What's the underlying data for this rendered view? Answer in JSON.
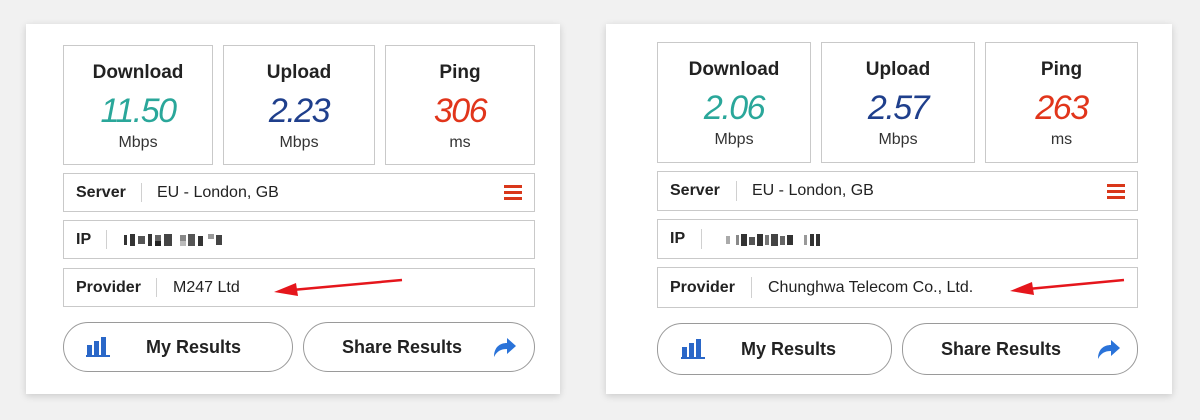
{
  "colors": {
    "download": "#2aa79a",
    "upload": "#1f3f8c",
    "ping": "#e1351b",
    "menu_icon": "#d9371a",
    "annotation_arrow": "#e5161c",
    "chart_icon": "#2a67c8",
    "share_icon": "#2a73d9"
  },
  "panels": [
    {
      "download": {
        "label": "Download",
        "value": "11.50",
        "unit": "Mbps"
      },
      "upload": {
        "label": "Upload",
        "value": "2.23",
        "unit": "Mbps"
      },
      "ping": {
        "label": "Ping",
        "value": "306",
        "unit": "ms"
      },
      "server": {
        "label": "Server",
        "value": "EU - London, GB",
        "menu_icon": "hamburger-menu-icon"
      },
      "ip": {
        "label": "IP"
      },
      "provider": {
        "label": "Provider",
        "value": "M247 Ltd"
      },
      "my_results": {
        "label": "My Results",
        "icon": "bar-chart-icon"
      },
      "share_results": {
        "label": "Share Results",
        "icon": "share-arrow-icon"
      }
    },
    {
      "download": {
        "label": "Download",
        "value": "2.06",
        "unit": "Mbps"
      },
      "upload": {
        "label": "Upload",
        "value": "2.57",
        "unit": "Mbps"
      },
      "ping": {
        "label": "Ping",
        "value": "263",
        "unit": "ms"
      },
      "server": {
        "label": "Server",
        "value": "EU - London, GB",
        "menu_icon": "hamburger-menu-icon"
      },
      "ip": {
        "label": "IP"
      },
      "provider": {
        "label": "Provider",
        "value": "Chunghwa Telecom Co., Ltd."
      },
      "my_results": {
        "label": "My Results",
        "icon": "bar-chart-icon"
      },
      "share_results": {
        "label": "Share Results",
        "icon": "share-arrow-icon"
      }
    }
  ]
}
